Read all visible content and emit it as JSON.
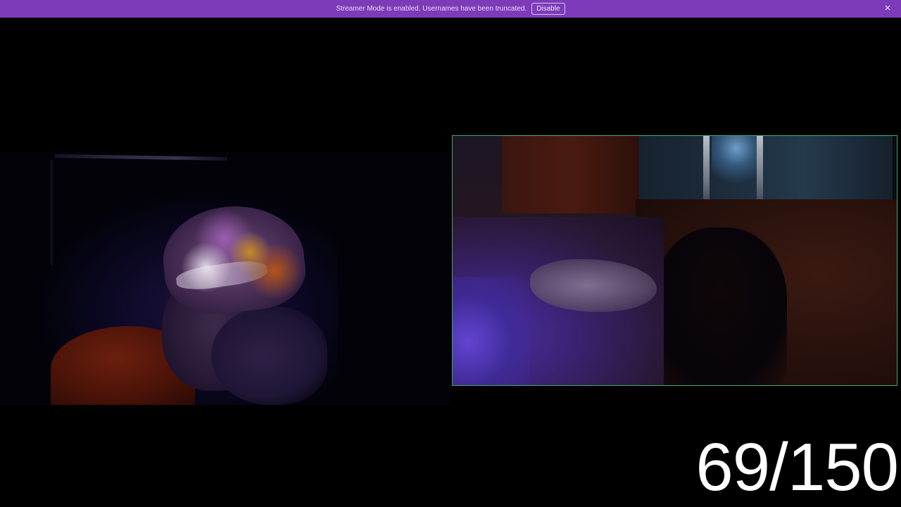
{
  "banner": {
    "message": "Streamer Mode is enabled. Usernames have been truncated.",
    "disable_label": "Disable",
    "close_icon": "×",
    "color": "#7d3bb9"
  },
  "videos": {
    "local": {
      "label": "local-camera-feed"
    },
    "remote": {
      "label": "remote-camera-feed",
      "border_color": "#3fa868"
    }
  },
  "counter": {
    "text": "69/150"
  }
}
